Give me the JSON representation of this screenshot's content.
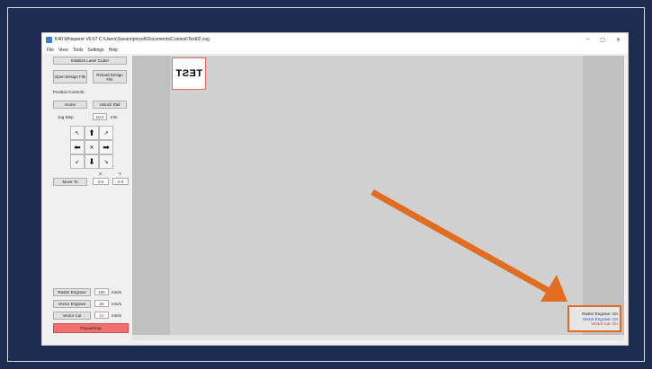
{
  "window": {
    "title": "K40 Whisperer V0.67   C:\\Users\\Savannpmcell\\Documents\\Contest\\Test02.svg",
    "controls": [
      "–",
      "▢",
      "✕"
    ]
  },
  "menu": [
    "File",
    "View",
    "Tools",
    "Settings",
    "Help"
  ],
  "left_panel": {
    "initialize_label": "Initialize Laser Cutter",
    "open_label": "Open Design File",
    "reload_label": "Reload Design File",
    "position_controls_label": "Position Controls:",
    "home_label": "Home",
    "unlock_label": "Unlock Rail",
    "jog_step_label": "Jog Step",
    "jog_step_value": "10.0",
    "jog_step_unit": "mm",
    "x_label": "X",
    "y_label": "Y",
    "move_to_label": "Move To",
    "move_to_x": "0.0",
    "move_to_y": "0.0",
    "raster_label": "Raster Engrave",
    "raster_value": "100",
    "raster_unit": "mm/s",
    "vector_engrave_label": "Vector Engrave",
    "vector_engrave_value": "20",
    "vector_engrave_unit": "mm/s",
    "vector_cut_label": "Vector Cut",
    "vector_cut_value": "10",
    "vector_cut_unit": "mm/s",
    "pause_stop_label": "Pause/Stop"
  },
  "jog": {
    "up_left": "↖",
    "up": "⬆",
    "up_right": "↗",
    "left": "⬅",
    "center": "✕",
    "right": "➡",
    "down_left": "↙",
    "down": "⬇",
    "down_right": "↘"
  },
  "design": {
    "text": "TEST"
  },
  "status": {
    "raster": "Raster Engrave: On",
    "vector_engrave": "Vector Engrave: On",
    "vector_cut": "Vector Cut: On"
  },
  "colors": {
    "background": "#1d2d52",
    "annotation_arrow": "#e06d20",
    "pause_button": "#f07070",
    "status_vector_engrave": "#2a4bd0",
    "status_vector_cut": "#d03030"
  }
}
